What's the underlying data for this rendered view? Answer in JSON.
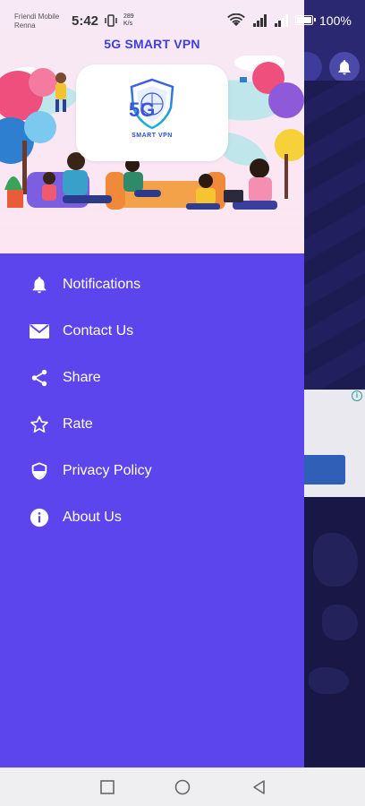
{
  "status_bar": {
    "carrier_line1": "Friendi Mobile",
    "carrier_line2": "Renna",
    "time": "5:42",
    "net_speed_value": "289",
    "net_speed_unit": "K/s",
    "battery_percent": "100%"
  },
  "drawer": {
    "app_title": "5G SMART VPN",
    "logo_text": "SMART VPN",
    "logo_mark": "5G",
    "items": [
      {
        "label": "Notifications",
        "icon": "bell-icon"
      },
      {
        "label": "Contact Us",
        "icon": "mail-icon"
      },
      {
        "label": "Share",
        "icon": "share-icon"
      },
      {
        "label": "Rate",
        "icon": "star-icon"
      },
      {
        "label": "Privacy Policy",
        "icon": "shield-icon"
      },
      {
        "label": "About Us",
        "icon": "info-icon"
      }
    ]
  },
  "nav_bar": {
    "buttons": [
      "recents-button",
      "home-button",
      "back-button"
    ]
  },
  "colors": {
    "drawer_bg": "#5d45ee",
    "header_bg": "#f8e8f4",
    "title_color": "#3d3fe0",
    "app_bg": "#1b1a4d"
  }
}
